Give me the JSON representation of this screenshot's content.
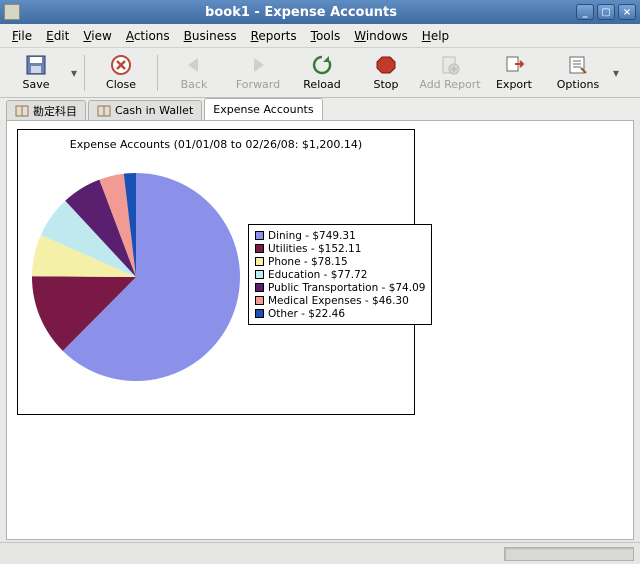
{
  "window": {
    "title": "book1 - Expense Accounts"
  },
  "menu": {
    "file": "File",
    "edit": "Edit",
    "view": "View",
    "actions": "Actions",
    "business": "Business",
    "reports": "Reports",
    "tools": "Tools",
    "windows": "Windows",
    "help": "Help"
  },
  "toolbar": {
    "save": "Save",
    "close": "Close",
    "back": "Back",
    "forward": "Forward",
    "reload": "Reload",
    "stop": "Stop",
    "add_report": "Add Report",
    "export": "Export",
    "options": "Options"
  },
  "tabs": {
    "t0": "勘定科目",
    "t1": "Cash in Wallet",
    "t2": "Expense Accounts"
  },
  "chart_data": {
    "type": "pie",
    "title": "Expense Accounts (01/01/08 to 02/26/08: $1,200.14)",
    "series": [
      {
        "name": "Dining",
        "value": 749.31,
        "label": "Dining - $749.31",
        "color": "#8b91e8"
      },
      {
        "name": "Utilities",
        "value": 152.11,
        "label": "Utilities - $152.11",
        "color": "#7a1846"
      },
      {
        "name": "Phone",
        "value": 78.15,
        "label": "Phone - $78.15",
        "color": "#f4f0a8"
      },
      {
        "name": "Education",
        "value": 77.72,
        "label": "Education - $77.72",
        "color": "#bfe9ef"
      },
      {
        "name": "Public Transportation",
        "value": 74.09,
        "label": "Public Transportation - $74.09",
        "color": "#5a1f6e"
      },
      {
        "name": "Medical Expenses",
        "value": 46.3,
        "label": "Medical Expenses - $46.30",
        "color": "#f29a94"
      },
      {
        "name": "Other",
        "value": 22.46,
        "label": "Other - $22.46",
        "color": "#1950b3"
      }
    ]
  }
}
